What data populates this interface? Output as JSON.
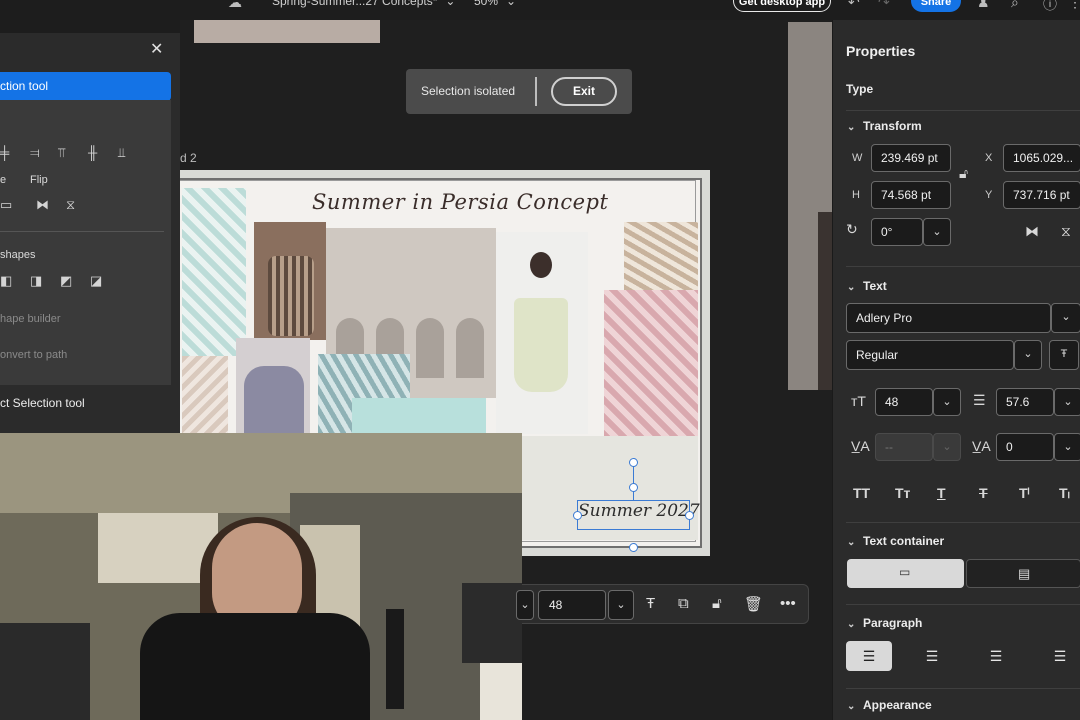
{
  "topbar": {
    "doc_name": "Spring-Summer...27 Concepts*",
    "zoom": "50%",
    "get_desktop_label": "Get desktop app",
    "share_label": "Share"
  },
  "canvas": {
    "artboard_label": "d 2",
    "toast_message": "Selection isolated",
    "toast_exit": "Exit",
    "board_title": "Summer in Persia Concept",
    "selected_text": "Summer 2027"
  },
  "left_panel": {
    "active_tool": "ction tool",
    "flip_label": "Flip",
    "e_label": "e",
    "shapes_label": "shapes",
    "shape_builder": "hape builder",
    "convert_path": "onvert to path",
    "bottom_item": "ct Selection tool"
  },
  "text_toolbar": {
    "font_size": "48"
  },
  "properties": {
    "title": "Properties",
    "type_label": "Type",
    "transform": {
      "section": "Transform",
      "w_label": "W",
      "w_value": "239.469 pt",
      "h_label": "H",
      "h_value": "74.568 pt",
      "x_label": "X",
      "x_value": "1065.029...",
      "y_label": "Y",
      "y_value": "737.716 pt",
      "rotation": "0°"
    },
    "text": {
      "section": "Text",
      "font_family": "Adlery Pro",
      "font_style": "Regular",
      "font_size": "48",
      "leading": "57.6",
      "kerning": "--",
      "tracking": "0"
    },
    "text_container": {
      "section": "Text container"
    },
    "paragraph": {
      "section": "Paragraph"
    },
    "appearance": {
      "section": "Appearance"
    }
  }
}
